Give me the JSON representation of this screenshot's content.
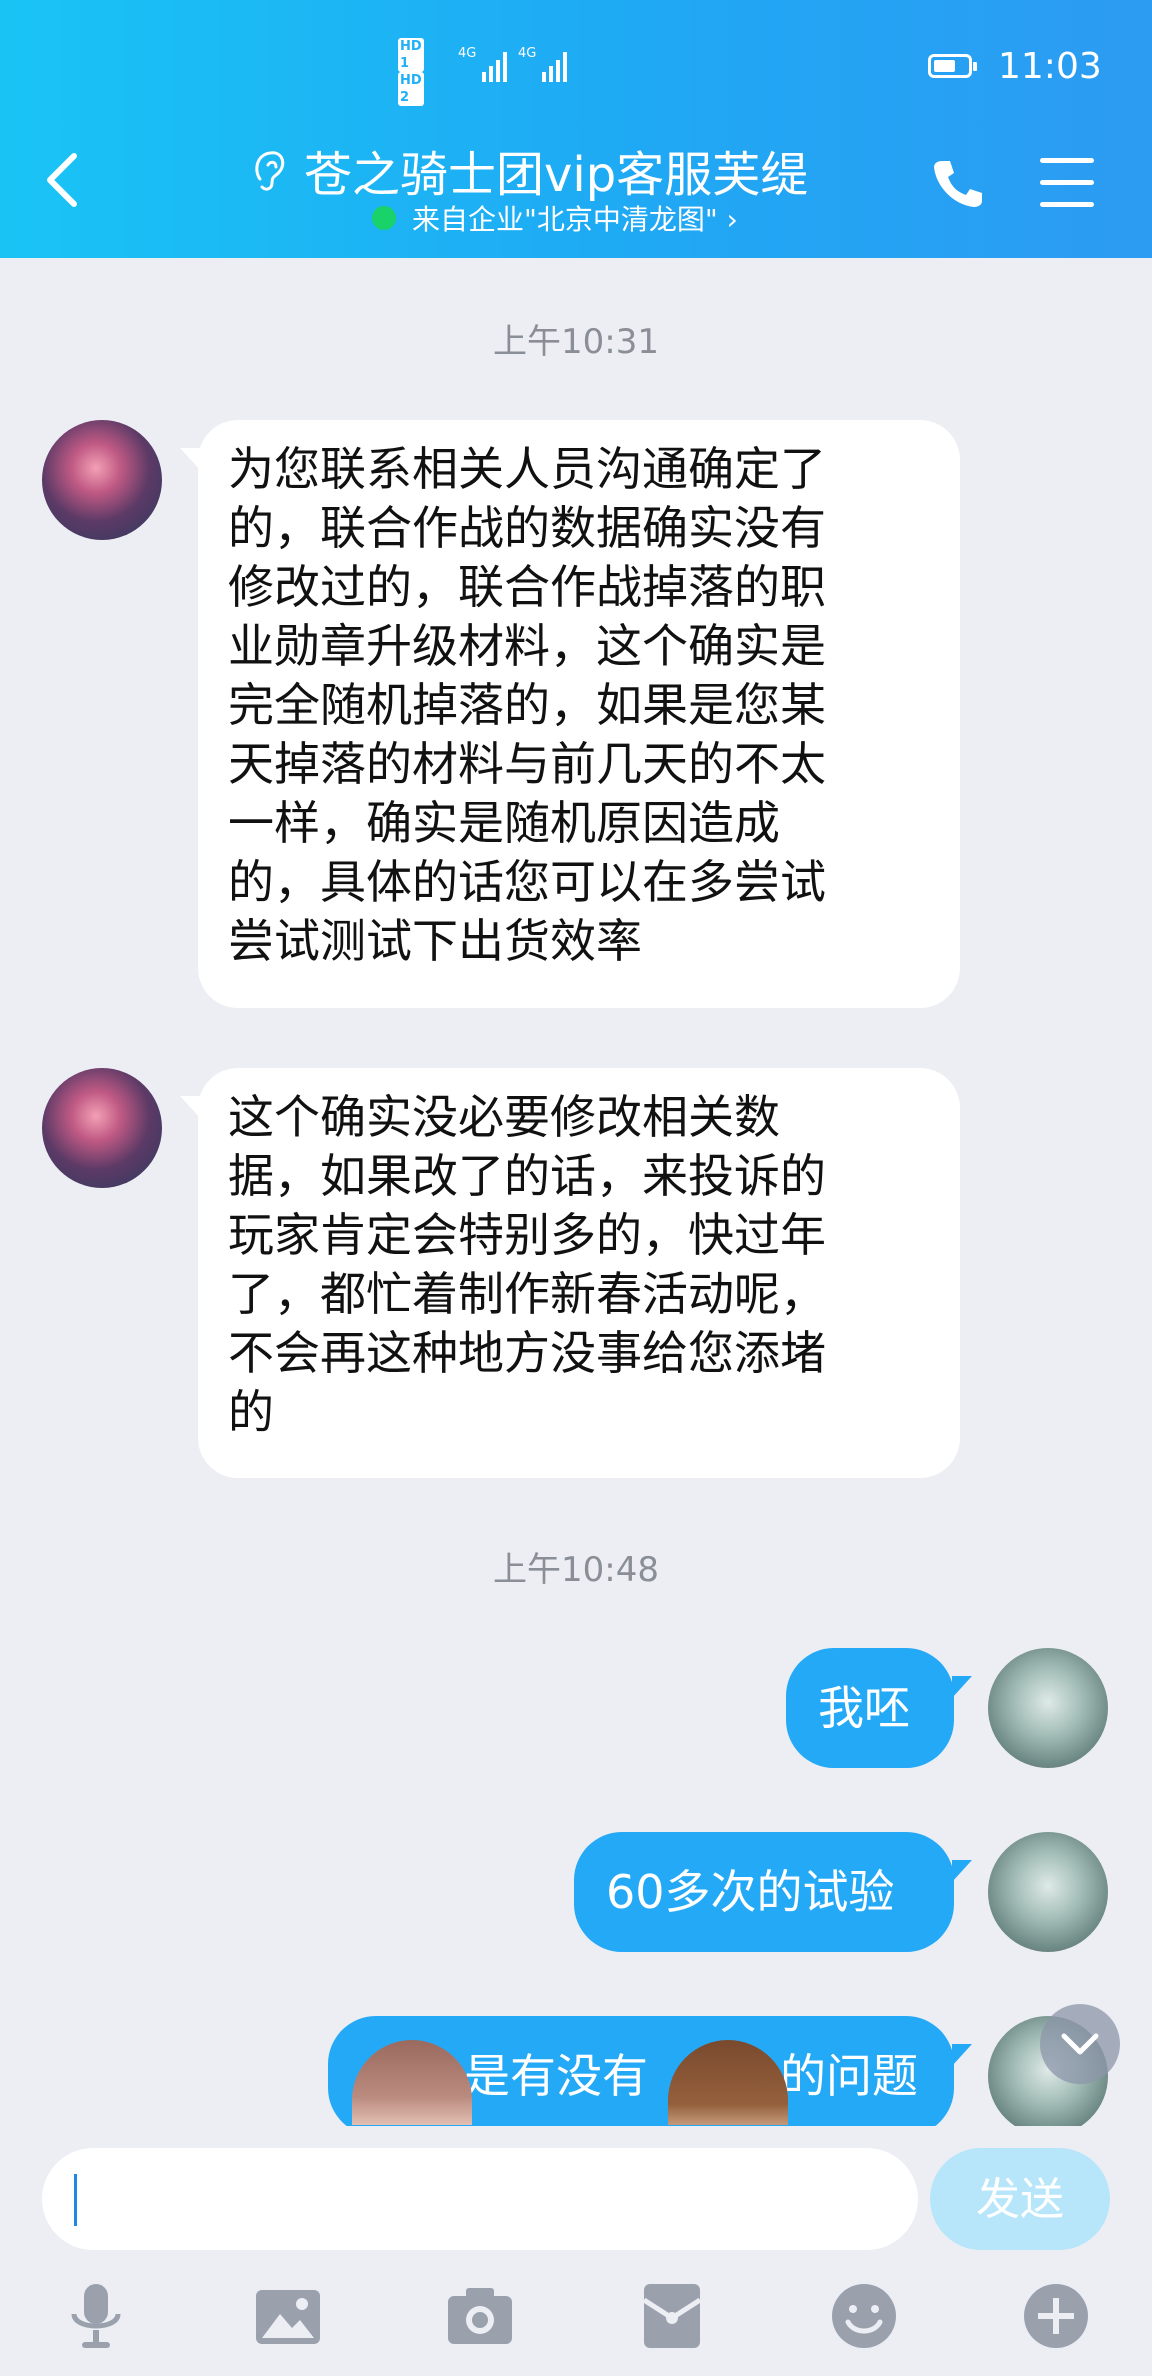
{
  "status_bar": {
    "sim1": "HD 1",
    "sim2": "HD 2",
    "network1": "4G",
    "network2": "4G",
    "battery_level": 0.65,
    "time": "11:03"
  },
  "header": {
    "title": "苍之骑士团vip客服芙缇",
    "subtitle": "来自企业\"北京中清龙图\" ›",
    "colors": {
      "gradient_start": "#19c4f5",
      "gradient_end": "#2c9bf2",
      "online_dot": "#19d26a"
    },
    "icons": [
      "back-arrow-icon",
      "ear-icon",
      "phone-icon",
      "menu-icon"
    ]
  },
  "messages": {
    "time1": "上午10:31",
    "msg1_lines": [
      "为您联系相关人员沟通确定了",
      "的，联合作战的数据确实没有",
      "修改过的，联合作战掉落的职",
      "业勋章升级材料，这个确实是",
      "完全随机掉落的，如果是您某",
      "天掉落的材料与前几天的不太",
      "一样，确实是随机原因造成",
      "的，具体的话您可以在多尝试",
      "尝试测试下出货效率"
    ],
    "msg2_lines": [
      "这个确实没必要修改相关数",
      "据，如果改了的话，来投诉的",
      "玩家肯定会特别多的，快过年",
      "了，都忙着制作新春活动呢，",
      "不会再这种地方没事给您添堵",
      "的"
    ],
    "time2": "上午10:48",
    "msg3": "我呸",
    "msg4": "60多次的试验",
    "msg5": "是有没有",
    "msg5_tail": "的问题"
  },
  "input": {
    "placeholder": "",
    "send_label": "发送"
  },
  "toolbar": [
    "microphone-icon",
    "image-icon",
    "camera-icon",
    "red-packet-icon",
    "emoji-icon",
    "plus-icon"
  ]
}
